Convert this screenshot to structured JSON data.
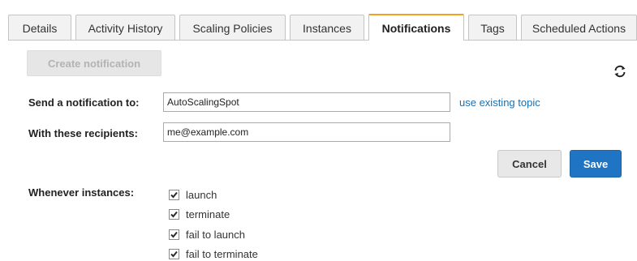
{
  "tabs": [
    {
      "label": "Details",
      "active": false
    },
    {
      "label": "Activity History",
      "active": false
    },
    {
      "label": "Scaling Policies",
      "active": false
    },
    {
      "label": "Instances",
      "active": false
    },
    {
      "label": "Notifications",
      "active": true
    },
    {
      "label": "Tags",
      "active": false
    },
    {
      "label": "Scheduled Actions",
      "active": false
    }
  ],
  "toolbar": {
    "create_label": "Create notification",
    "refresh_icon": "refresh-icon"
  },
  "form": {
    "send_label": "Send a notification to:",
    "send_value": "AutoScalingSpot",
    "existing_topic_link": "use existing topic",
    "recipients_label": "With these recipients:",
    "recipients_value": "me@example.com",
    "cancel_label": "Cancel",
    "save_label": "Save",
    "whenever_label": "Whenever instances:",
    "events": [
      {
        "label": "launch",
        "checked": true
      },
      {
        "label": "terminate",
        "checked": true
      },
      {
        "label": "fail to launch",
        "checked": true
      },
      {
        "label": "fail to terminate",
        "checked": true
      }
    ]
  },
  "colors": {
    "active_tab_accent": "#f0a022",
    "primary_button": "#1f75c4",
    "link": "#1a6fb0"
  }
}
